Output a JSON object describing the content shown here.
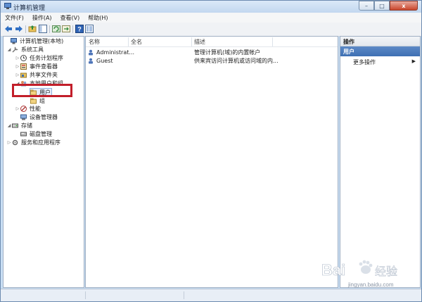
{
  "window": {
    "title": "计算机管理",
    "icon": "computer-management-icon"
  },
  "title_controls": {
    "minimize": "–",
    "maximize": "□",
    "close": "x"
  },
  "menu": [
    "文件(F)",
    "操作(A)",
    "查看(V)",
    "帮助(H)"
  ],
  "toolbar": [
    "back-arrow-icon",
    "forward-arrow-icon",
    "up-folder-icon",
    "show-hide-tree-icon",
    "refresh-icon",
    "export-list-icon",
    "help-icon",
    "properties-icon"
  ],
  "tree": [
    {
      "label": "计算机管理(本地)",
      "level": 0,
      "icon": "computer-icon",
      "expander": ""
    },
    {
      "label": "系统工具",
      "level": 1,
      "icon": "tools-icon",
      "expander": "◢"
    },
    {
      "label": "任务计划程序",
      "level": 2,
      "icon": "clock-icon",
      "expander": "▷"
    },
    {
      "label": "事件查看器",
      "level": 2,
      "icon": "event-viewer-icon",
      "expander": "▷"
    },
    {
      "label": "共享文件夹",
      "level": 2,
      "icon": "shared-folder-icon",
      "expander": "▷"
    },
    {
      "label": "本地用户和组",
      "level": 2,
      "icon": "users-group-icon",
      "expander": "◢"
    },
    {
      "label": "用户",
      "level": 3,
      "icon": "folder-icon",
      "expander": "",
      "selected": true
    },
    {
      "label": "组",
      "level": 3,
      "icon": "folder-icon",
      "expander": ""
    },
    {
      "label": "性能",
      "level": 2,
      "icon": "performance-icon",
      "expander": "▷"
    },
    {
      "label": "设备管理器",
      "level": 2,
      "icon": "device-manager-icon",
      "expander": ""
    },
    {
      "label": "存储",
      "level": 1,
      "icon": "storage-icon",
      "expander": "◢"
    },
    {
      "label": "磁盘管理",
      "level": 2,
      "icon": "disk-icon",
      "expander": ""
    },
    {
      "label": "服务和应用程序",
      "level": 1,
      "icon": "services-icon",
      "expander": "▷"
    }
  ],
  "list": {
    "columns": [
      "名称",
      "全名",
      "描述"
    ],
    "rows": [
      {
        "name": "Administrat...",
        "full_name": "",
        "description": "管理计算机(域)的内置帐户",
        "icon": "user-icon"
      },
      {
        "name": "Guest",
        "full_name": "",
        "description": "供来宾访问计算机或访问域的内...",
        "icon": "user-icon"
      }
    ]
  },
  "actions": {
    "title": "操作",
    "section": "用户",
    "items": [
      "更多操作"
    ]
  },
  "watermark": {
    "text": "Bai",
    "suffix": "经验",
    "url": "jingyan.baidu.com"
  },
  "colors": {
    "highlight_box": "#c21e2a",
    "action_section": "#4a78ba"
  }
}
